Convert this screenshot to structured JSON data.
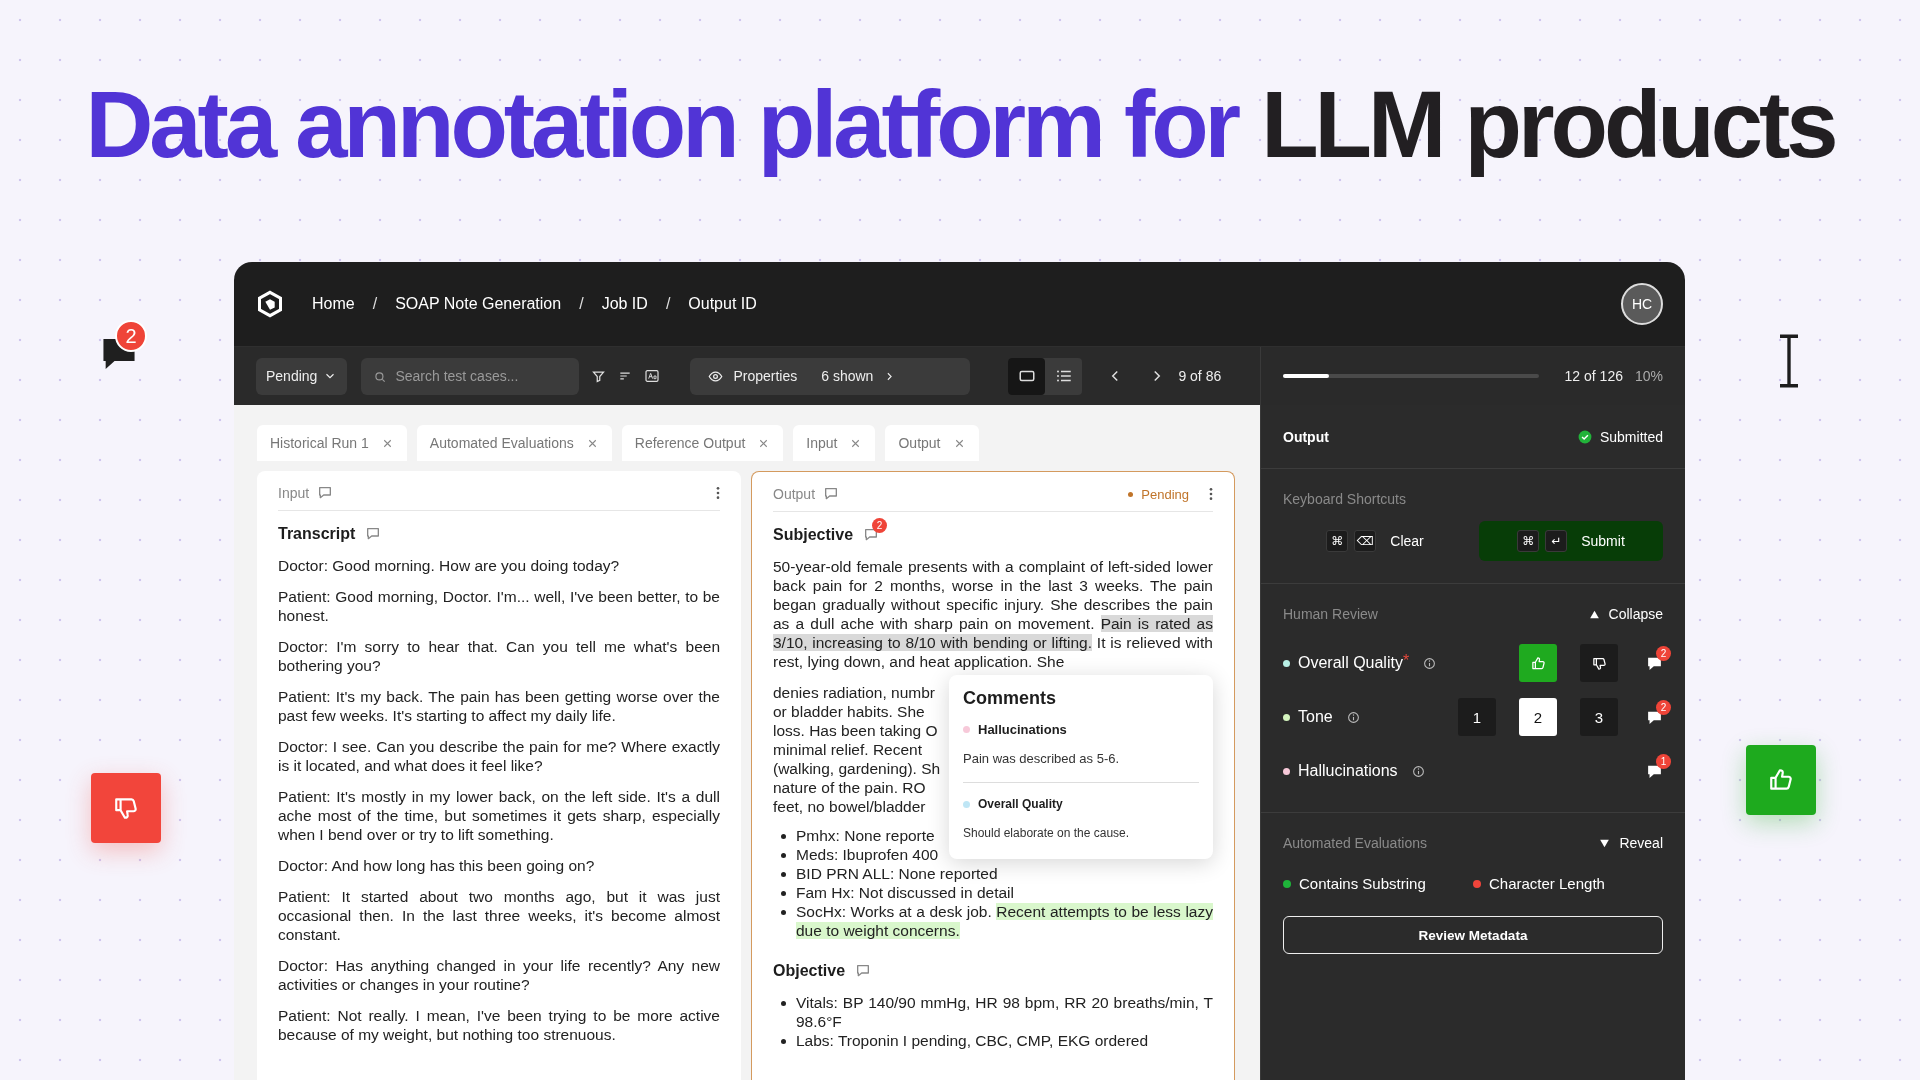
{
  "headline": {
    "accent": "Data annotation platform for",
    "rest": "LLM products"
  },
  "decorations": [
    {
      "kind": "chat",
      "badge": "2"
    },
    {
      "kind": "thumbs-down"
    },
    {
      "kind": "thumbs-up"
    },
    {
      "kind": "text-cursor"
    }
  ],
  "window": {
    "breadcrumbs": [
      {
        "label": "Home"
      },
      {
        "separator": "/",
        "label": "SOAP Note Generation"
      },
      {
        "separator": "/",
        "label": "Job ID"
      },
      {
        "separator": "/",
        "label": "Output ID"
      }
    ],
    "avatar": "HC",
    "toolbar": {
      "status_filter": "Pending",
      "search": {
        "placeholder": "Search test cases..."
      },
      "properties": {
        "label": "Properties",
        "count": "6 shown"
      },
      "views": [
        {
          "kind": "single",
          "selected": true
        },
        {
          "kind": "list",
          "selected": false
        }
      ],
      "pager": "9 of 86"
    },
    "progress": {
      "level": 0.18,
      "reading": "12 of 126",
      "percent": "10%"
    },
    "tabs": [
      {
        "label": "Historical Run 1"
      },
      {
        "label": "Automated Evaluations"
      },
      {
        "label": "Reference Output"
      },
      {
        "label": "Input"
      },
      {
        "label": "Output"
      }
    ],
    "input_panel": {
      "header": "Input",
      "title": "Transcript",
      "paragraphs": [
        "Doctor: Good morning. How are you doing today?",
        "Patient: Good morning, Doctor. I'm... well, I've been better, to be honest.",
        "Doctor: I'm sorry to hear that. Can you tell me what's been bothering you?",
        "Patient: It's my back. The pain has been getting worse over the past few weeks. It's starting to affect my daily life.",
        "Doctor: I see. Can you describe the pain for me? Where exactly is it located, and what does it feel like?",
        "Patient: It's mostly in my lower back, on the left side. It's a dull ache most of the time, but sometimes it gets sharp, especially when I bend over or try to lift something.",
        "Doctor: And how long has this been going on?",
        "Patient: It started about two months ago, but it was just occasional then. In the last three weeks, it's become almost constant.",
        "Doctor: Has anything changed in your life recently? Any new activities or changes in your routine?",
        "Patient: Not really. I mean, I've been trying to be more active because of my weight, but nothing too strenuous."
      ]
    },
    "output_panel": {
      "header": "Output",
      "status": "Pending",
      "subjective": {
        "title": "Subjective",
        "comment_count": "2",
        "paragraph": [
          {
            "text": "50-year-old female presents with a complaint of left-sided lower back pain for 2 months, worse in the last 3 weeks. The pain began gradually without specific injury. She describes the pain as a dull ache with sharp pain on movement. ",
            "kind": "plain"
          },
          {
            "text": "Pain is rated as 3/10, increasing to 8/10 with bending or lifting.",
            "kind": "selected"
          },
          {
            "text": " It is relieved with rest, lying down, and heat application. She",
            "kind": "plain"
          }
        ],
        "covered_lines": [
          "denies radiation, numbr",
          "or bladder habits. She",
          "loss. Has been taking O",
          "minimal relief. Recent",
          "(walking, gardening). Sh",
          "nature of the pain. RO",
          "feet, no bowel/bladder"
        ],
        "covered_bullets": [
          "Pmhx: None reporte",
          "Meds: Ibuprofen 400"
        ],
        "bullets": [
          [
            {
              "text": "BID PRN ALL: None reported",
              "kind": "plain"
            }
          ],
          [
            {
              "text": "Fam Hx: Not discussed in detail",
              "kind": "plain"
            }
          ],
          [
            {
              "text": "SocHx: Works at a desk job. ",
              "kind": "plain"
            },
            {
              "text": "Recent attempts to be less lazy due to weight concerns.",
              "kind": "marked"
            }
          ]
        ]
      },
      "objective": {
        "title": "Objective",
        "bullets": [
          "Vitals: BP 140/90 mmHg, HR 98 bpm, RR 20 breaths/min, T 98.6°F",
          "Labs: Troponin I pending, CBC, CMP, EKG ordered"
        ]
      },
      "comments_popup": {
        "title": "Comments",
        "items": [
          {
            "label": "Hallucinations",
            "color": "#f7c9d9",
            "text": "Pain was described as 5-6."
          },
          {
            "label": "Overall Quality",
            "color": "#bfe6f5",
            "text": "Should elaborate on the cause."
          }
        ]
      }
    },
    "review_panel": {
      "title": "Output",
      "status": "Submitted",
      "shortcuts_label": "Keyboard Shortcuts",
      "shortcuts": [
        {
          "keys": [
            "⌘",
            "⌫"
          ],
          "label": "Clear",
          "primary": false
        },
        {
          "keys": [
            "⌘",
            "↵"
          ],
          "label": "Submit",
          "primary": true
        }
      ],
      "human_review": {
        "title": "Human Review",
        "toggle": "Collapse",
        "expanded": true,
        "criteria": [
          {
            "name": "Overall Quality",
            "asterisk": "*",
            "color": "#b9f0e6",
            "kind": "thumbs",
            "options": [
              {
                "kind": "up",
                "selected": true
              },
              {
                "kind": "down",
                "selected": false
              }
            ],
            "comments": "2"
          },
          {
            "name": "Tone",
            "color": "#d5f5bf",
            "kind": "scale",
            "options": [
              {
                "label": "1",
                "selected": false
              },
              {
                "label": "2",
                "selected": true
              },
              {
                "label": "3",
                "selected": false
              }
            ],
            "comments": "2"
          },
          {
            "name": "Hallucinations",
            "color": "#f7c9d9",
            "kind": "plain",
            "comments": "1"
          }
        ]
      },
      "automated": {
        "title": "Automated Evaluations",
        "toggle": "Reveal",
        "expanded": false,
        "items": [
          {
            "name": "Contains Substring",
            "color": "#1fb53a"
          },
          {
            "name": "Character Length",
            "color": "#f0453b"
          }
        ]
      },
      "metadata_button": "Review Metadata"
    }
  }
}
